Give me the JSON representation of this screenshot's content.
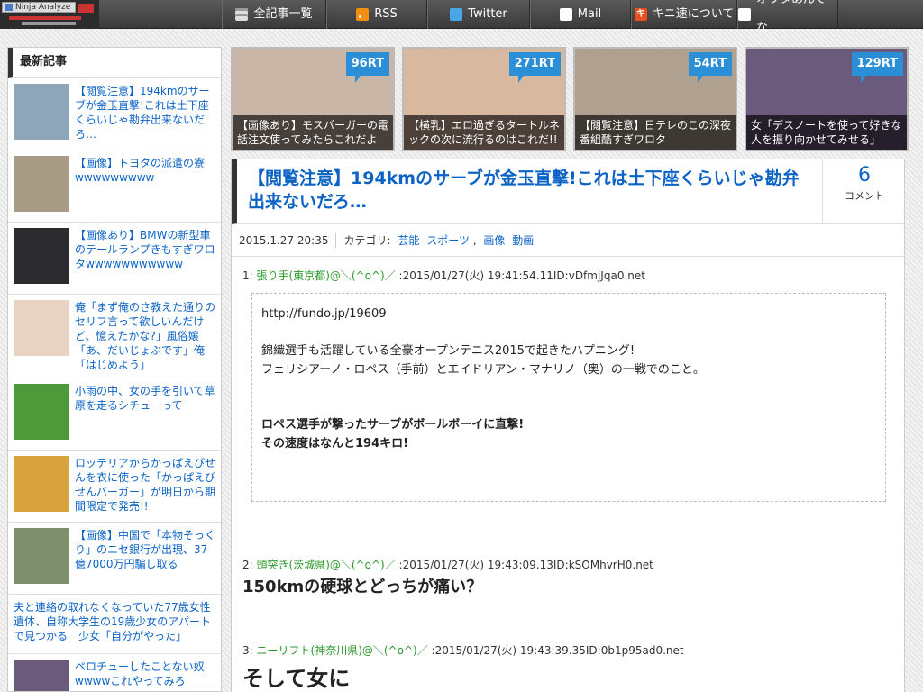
{
  "nav": {
    "items": [
      {
        "label": "全記事一覧",
        "icon": "list-icon"
      },
      {
        "label": "RSS",
        "icon": "rss-icon"
      },
      {
        "label": "Twitter",
        "icon": "twitter-icon"
      },
      {
        "label": "Mail",
        "icon": "mail-icon"
      },
      {
        "label": "キニ速について",
        "icon": "kini-icon",
        "icon_glyph": "キ"
      },
      {
        "label": "オワタあんてな",
        "icon": "owata-icon"
      }
    ],
    "logo_text": "Ninja Analyze"
  },
  "sidebar": {
    "title": "最新記事",
    "items": [
      {
        "text": "【閲覧注意】194kmのサーブが金玉直撃!これは土下座くらいじゃ勘弁出来ないだろ…",
        "thumb_color": "#8fa6b8"
      },
      {
        "text": "【画像】トヨタの派遣の寮wwwwwwwww",
        "thumb_color": "#a89c86"
      },
      {
        "text": "【画像あり】BMWの新型車のテールランプきもすぎワロタwwwwwwwwwww",
        "thumb_color": "#2b2b30"
      },
      {
        "text": "俺「まず俺のさ教えた通りのセリフ言って欲しいんだけど、憶えたかな?」風俗嬢「あ、だいじょぶです」俺「はじめよう」",
        "thumb_color": "#e9d4c4"
      },
      {
        "text": "小雨の中、女の手を引いて草原を走るシチューって",
        "thumb_color": "#4e9a3a"
      },
      {
        "text": "ロッテリアからかっぱえびせんを衣に使った「かっぱえびせんバーガー」が明日から期間限定で発売!!",
        "thumb_color": "#d8a23c"
      },
      {
        "text": "【画像】中国で「本物そっくり」のニセ銀行が出現、37億7000万円騙し取る",
        "thumb_color": "#7d8f6c"
      },
      {
        "text": "夫と連絡の取れなくなっていた77歳女性遺体、自称大学生の19歳少女のアパートで見つかる　少女「自分がやった」",
        "thumb_color": ""
      },
      {
        "text": "ペロチューしたことない奴wwwwこれやってみろ",
        "thumb_color": "#6b5a7a"
      }
    ]
  },
  "ranking": [
    {
      "rt": "96RT",
      "caption": "【画像あり】モスバーガーの電話注文使ってみたらこれだよ",
      "bg": "#c9b6a6"
    },
    {
      "rt": "271RT",
      "caption": "【横乳】エロ過ぎるタートルネックの次に流行るのはこれだ!!",
      "bg": "#d9b8a0"
    },
    {
      "rt": "54RT",
      "caption": "【閲覧注意】日テレのこの深夜番組酷すぎワロタ",
      "bg": "#b0a090"
    },
    {
      "rt": "129RT",
      "caption": "女「デスノートを使って好きな人を振り向かせてみせる」",
      "bg": "#6a5a7c"
    }
  ],
  "article": {
    "title": "【閲覧注意】194kmのサーブが金玉直撃!これは土下座くらいじゃ勘弁出来ないだろ…",
    "comment_count": "6",
    "comment_label": "コメント",
    "date": "2015.1.27 20:35",
    "category_label": "カテゴリ:",
    "categories": [
      "芸能",
      "スポーツ",
      "画像",
      "動画"
    ],
    "responses": [
      {
        "num": "1:",
        "name": "張り手(東京都)@＼(^o^)／",
        "meta": ":2015/01/27(火) 19:41:54.11ID:vDfmjJqa0.net",
        "url": "http://fundo.jp/19609",
        "line1": "錦織選手も活躍している全豪オープンテニス2015で起きたハプニング!",
        "line2": "フェリシアーノ・ロペス（手前）とエイドリアン・マナリノ（奥）の一戦でのこと。",
        "bold1": "ロペス選手が撃ったサーブがボールボーイに直撃!",
        "bold2": "その速度はなんと194キロ!"
      },
      {
        "num": "2:",
        "name": "頭突き(茨城県)@＼(^o^)／",
        "meta": ":2015/01/27(火) 19:43:09.13ID:kSOMhvrH0.net",
        "text": "150kmの硬球とどっちが痛い？"
      },
      {
        "num": "3:",
        "name": "ニーリフト(神奈川県)@＼(^o^)／",
        "meta": ":2015/01/27(火) 19:43:39.35ID:0b1p95ad0.net",
        "text": "そして女に"
      }
    ]
  }
}
